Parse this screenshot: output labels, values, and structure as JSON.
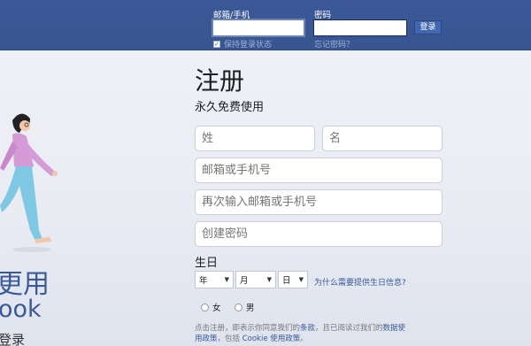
{
  "header": {
    "email_label": "邮箱/手机",
    "email_value": "",
    "password_label": "密码",
    "password_value": "",
    "login_label": "登录",
    "keep_logged_in": "保持登录状态",
    "forgot_password": "忘记密码？"
  },
  "left": {
    "tagline_1": "更用",
    "tagline_2": "ook",
    "tagline_3": "登录"
  },
  "signup": {
    "title": "注册",
    "subtitle": "永久免费使用",
    "last_name_placeholder": "姓",
    "first_name_placeholder": "名",
    "email_placeholder": "邮箱或手机号",
    "email_confirm_placeholder": "再次输入邮箱或手机号",
    "password_placeholder": "创建密码",
    "birthday_label": "生日",
    "year_label": "年",
    "month_label": "月",
    "day_label": "日",
    "why_birthday": "为什么需要提供生日信息?",
    "female_label": "女",
    "male_label": "男",
    "terms_1": "点击注册，即表示你同意我们的",
    "terms_link_1": "条款",
    "terms_2": "，且已阅读过我们的",
    "terms_link_2": "数据使用政策",
    "terms_3": "，包括 ",
    "terms_link_3": "Cookie 使用政策",
    "terms_4": "。"
  },
  "colors": {
    "brand": "#3b5998",
    "link": "#385898"
  }
}
